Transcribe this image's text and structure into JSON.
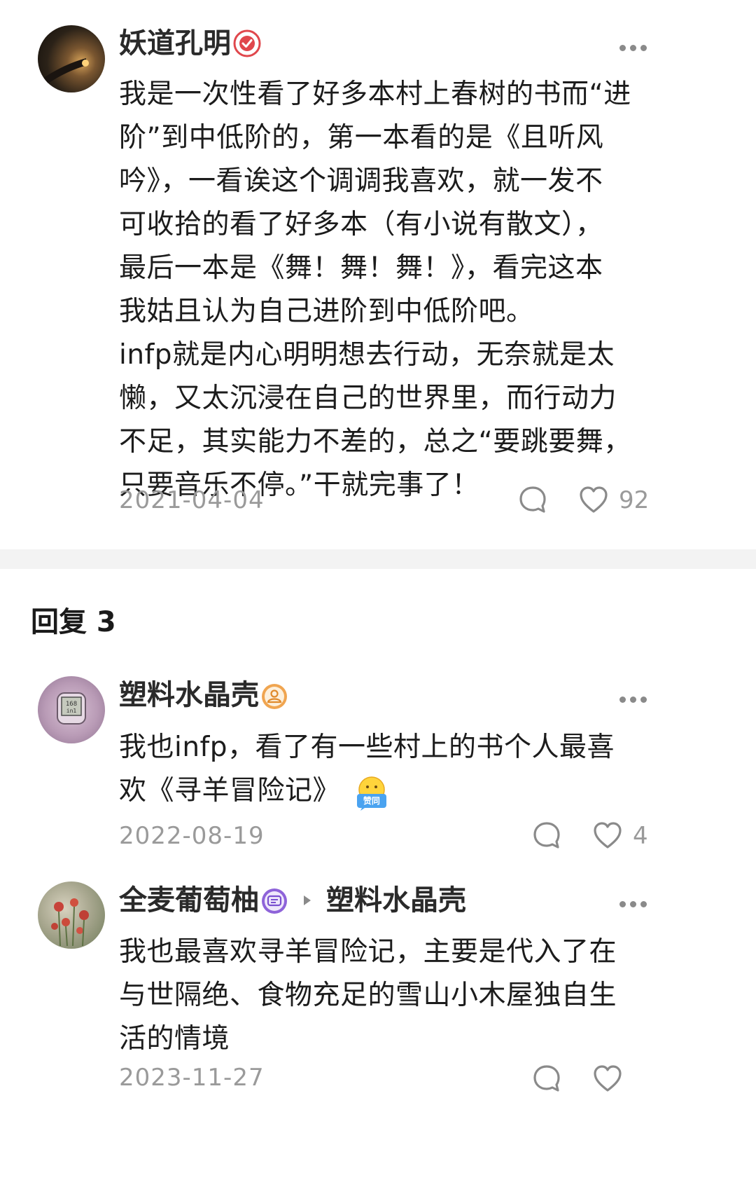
{
  "post": {
    "author": "妖道孔明",
    "body": [
      "我是一次性看了好多本村上春树的书而“进",
      "阶”到中低阶的，第一本看的是《且听风",
      "吟》，一看诶这个调调我喜欢，就一发不",
      "可收拾的看了好多本（有小说有散文），",
      "最后一本是《舞！舞！舞！》，看完这本",
      "我姑且认为自己进阶到中低阶吧。",
      "infp就是内心明明想去行动，无奈就是太",
      "懒，又太沉浸在自己的世界里，而行动力",
      "不足，其实能力不差的，总之“要跳要舞，",
      "只要音乐不停。”干就完事了！"
    ],
    "date": "2021-04-04",
    "likes": "92"
  },
  "replies_header": "回复 3",
  "replies": [
    {
      "author": "塑料水晶壳",
      "avatar_text": [
        "168",
        "in1"
      ],
      "body": [
        "我也infp，看了有一些村上的书个人最喜",
        "欢《寻羊冒险记》"
      ],
      "emoji_label": "赞同",
      "date": "2022-08-19",
      "likes": "4"
    },
    {
      "author": "全麦葡萄柚",
      "reply_to": "塑料水晶壳",
      "body": [
        "我也最喜欢寻羊冒险记，主要是代入了在",
        "与世隔绝、食物充足的雪山小木屋独自生",
        "活的情境"
      ],
      "date": "2023-11-27"
    }
  ],
  "colors": {
    "accent_red": "#e0474c",
    "badge_orange": "#f0a550",
    "badge_purple": "#8e63d9",
    "meta_gray": "#9a9a9a"
  }
}
